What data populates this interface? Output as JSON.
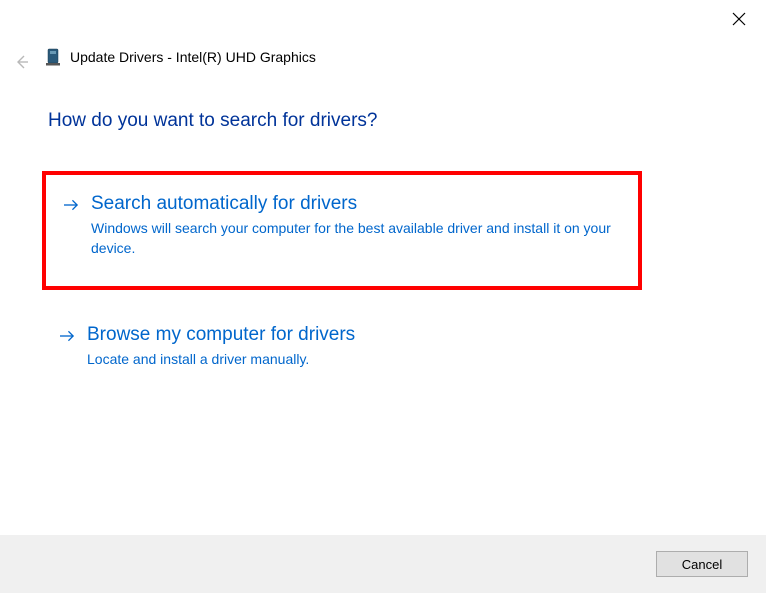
{
  "header": {
    "title": "Update Drivers - Intel(R) UHD Graphics"
  },
  "question": "How do you want to search for drivers?",
  "options": [
    {
      "title": "Search automatically for drivers",
      "description": "Windows will search your computer for the best available driver and install it on your device."
    },
    {
      "title": "Browse my computer for drivers",
      "description": "Locate and install a driver manually."
    }
  ],
  "footer": {
    "cancel_label": "Cancel"
  }
}
